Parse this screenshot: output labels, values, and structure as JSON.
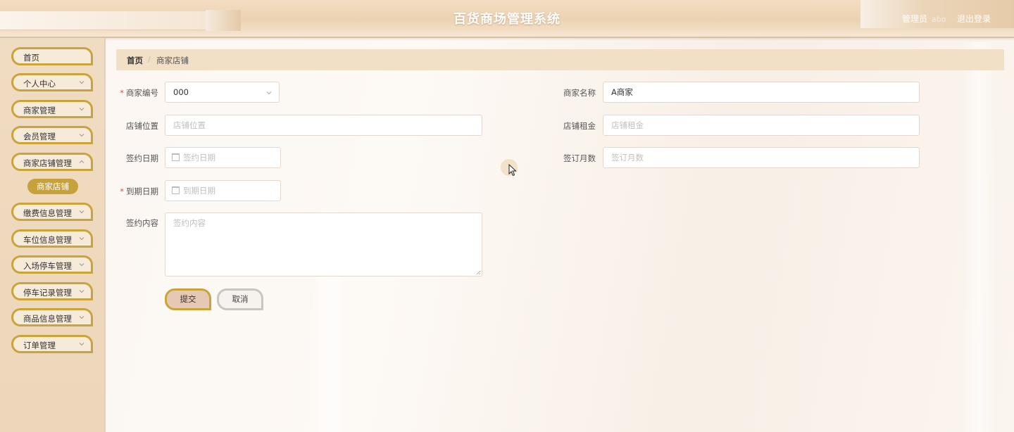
{
  "header": {
    "title": "百货商场管理系统",
    "user_role": "管理员",
    "username": "abo",
    "logout": "退出登录"
  },
  "sidebar": {
    "items": [
      {
        "label": "首页",
        "has_children": false
      },
      {
        "label": "个人中心",
        "has_children": true
      },
      {
        "label": "商家管理",
        "has_children": true
      },
      {
        "label": "会员管理",
        "has_children": true
      },
      {
        "label": "商家店铺管理",
        "has_children": true
      },
      {
        "label": "缴费信息管理",
        "has_children": true
      },
      {
        "label": "车位信息管理",
        "has_children": true
      },
      {
        "label": "入场停车管理",
        "has_children": true
      },
      {
        "label": "停车记录管理",
        "has_children": true
      },
      {
        "label": "商品信息管理",
        "has_children": true
      },
      {
        "label": "订单管理",
        "has_children": true
      }
    ],
    "active_sub": "商家店铺"
  },
  "breadcrumb": {
    "home": "首页",
    "separator": "/",
    "current": "商家店铺"
  },
  "form": {
    "merchant_no": {
      "label": "商家编号",
      "required": true,
      "value": "000"
    },
    "merchant_name": {
      "label": "商家名称",
      "required": false,
      "value": "A商家"
    },
    "shop_location": {
      "label": "店铺位置",
      "required": false,
      "placeholder": "店铺位置"
    },
    "shop_rent": {
      "label": "店铺租金",
      "required": false,
      "placeholder": "店铺租金"
    },
    "sign_date": {
      "label": "签约日期",
      "required": false,
      "placeholder": "签约日期"
    },
    "sign_months": {
      "label": "签订月数",
      "required": false,
      "placeholder": "签订月数"
    },
    "expire_date": {
      "label": "到期日期",
      "required": true,
      "placeholder": "到期日期"
    },
    "sign_content": {
      "label": "签约内容",
      "required": false,
      "placeholder": "签约内容"
    }
  },
  "buttons": {
    "submit": "提交",
    "cancel": "取消"
  },
  "colors": {
    "accent_gold": "#caa33a",
    "header_bg": "#ecd2b2",
    "sidebar_bg": "#f0dcc2",
    "breadcrumb_bg": "#f1dfc6",
    "required_mark": "#e05050"
  }
}
